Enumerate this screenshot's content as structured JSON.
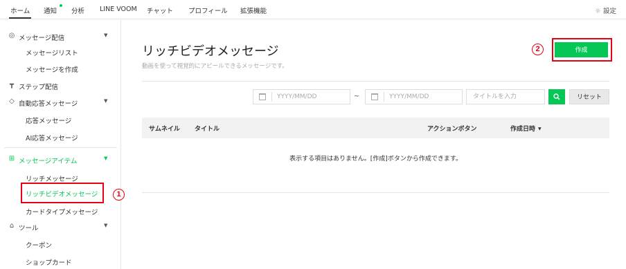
{
  "topnav": {
    "items": [
      "ホーム",
      "通知",
      "分析",
      "LINE VOOM",
      "チャット",
      "プロフィール",
      "拡張機能"
    ],
    "settings_label": "設定",
    "settings_icon": "gear-icon",
    "accent_color": "#06c755"
  },
  "sidebar": {
    "groups": [
      {
        "label": "メッセージ配信",
        "icon": "broadcast-icon",
        "expanded": true,
        "children": [
          "メッセージリスト",
          "メッセージを作成"
        ]
      },
      {
        "label": "ステップ配信",
        "icon": "step-icon",
        "expanded": false,
        "children": []
      },
      {
        "label": "自動応答メッセージ",
        "icon": "auto-reply-icon",
        "expanded": true,
        "children": [
          "応答メッセージ",
          "AI応答メッセージ"
        ]
      },
      {
        "label": "メッセージアイテム",
        "icon": "message-item-icon",
        "expanded": true,
        "active": true,
        "children": [
          "リッチメッセージ",
          "リッチビデオメッセージ",
          "カードタイプメッセージ"
        ]
      },
      {
        "label": "ツール",
        "icon": "shop-icon",
        "expanded": true,
        "children": [
          "クーポン",
          "ショップカード"
        ]
      }
    ],
    "active_item": "リッチビデオメッセージ"
  },
  "annotations": {
    "step1": "1",
    "step2": "2",
    "highlight_color": "#e60012"
  },
  "main": {
    "title": "リッチビデオメッセージ",
    "subtitle": "動画を使って視覚的にアピールできるメッセージです。",
    "create_button": "作成",
    "filters": {
      "date_from_placeholder": "YYYY/MM/DD",
      "date_separator": "~",
      "date_to_placeholder": "YYYY/MM/DD",
      "title_placeholder": "タイトルを入力",
      "reset_label": "リセット"
    },
    "table": {
      "columns": [
        "サムネイル",
        "タイトル",
        "アクションボタン",
        "作成日時"
      ],
      "sort_column": "作成日時",
      "empty_message": "表示する項目はありません。[作成]ボタンから作成できます。"
    }
  }
}
